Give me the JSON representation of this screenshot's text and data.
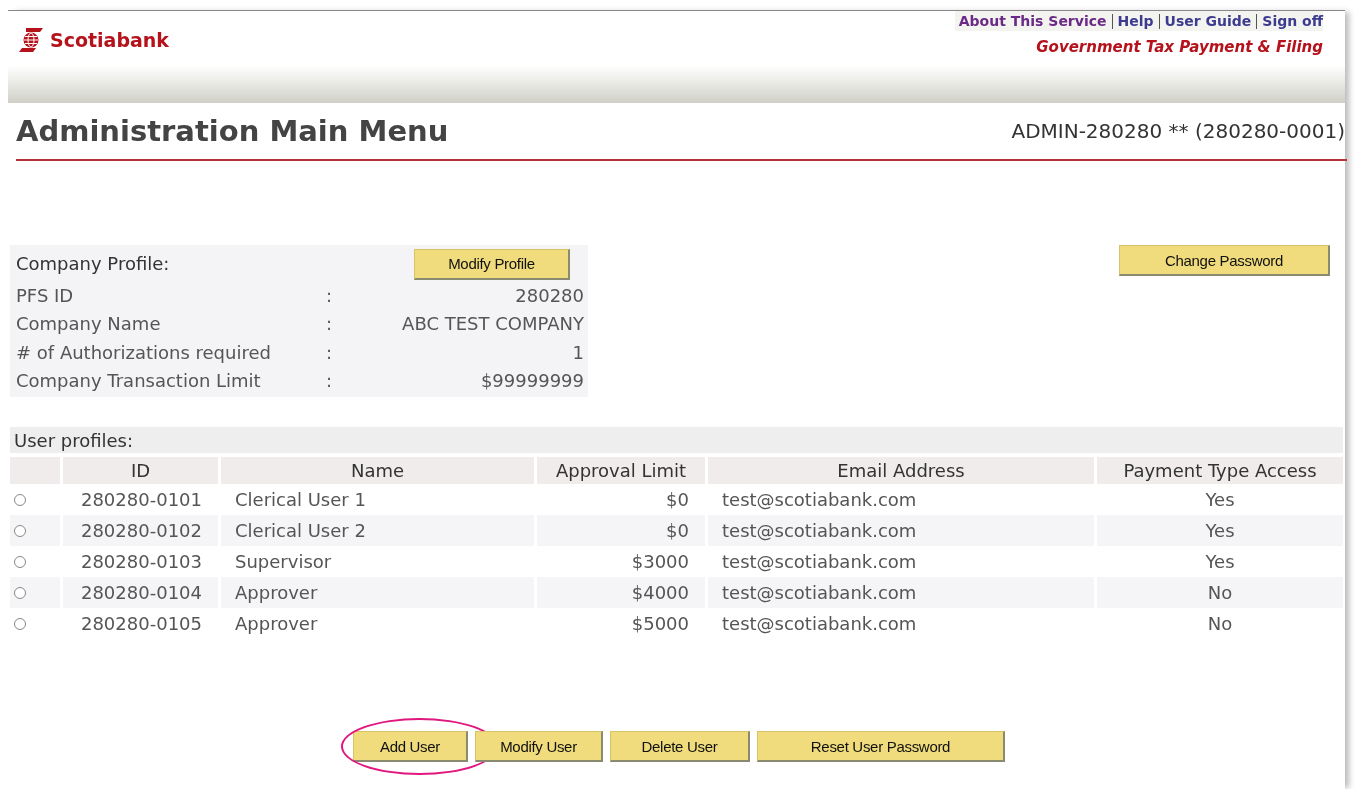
{
  "header": {
    "brand": "Scotiabank",
    "links": [
      "About This Service",
      "Help",
      "User Guide",
      "Sign off"
    ],
    "service": "Government Tax Payment & Filing"
  },
  "page": {
    "title": "Administration Main Menu",
    "user": "ADMIN-280280 ** (280280-0001)"
  },
  "company_profile": {
    "heading": "Company Profile:",
    "button": "Modify Profile",
    "fields": [
      {
        "label": "PFS ID",
        "separator": ":",
        "value": "280280"
      },
      {
        "label": "Company Name",
        "separator": ":",
        "value": "ABC TEST COMPANY"
      },
      {
        "label": "# of Authorizations required",
        "separator": ":",
        "value": "1"
      },
      {
        "label": "Company Transaction Limit",
        "separator": ":",
        "value": "$99999999"
      }
    ]
  },
  "change_password": "Change Password",
  "user_profiles": {
    "heading": "User profiles:",
    "columns": [
      "ID",
      "Name",
      "Approval Limit",
      "Email Address",
      "Payment Type Access"
    ],
    "rows": [
      {
        "selected": false,
        "id": "280280-0101",
        "name": "Clerical User 1",
        "limit": "$0",
        "email": "test@scotiabank.com",
        "access": "Yes"
      },
      {
        "selected": false,
        "id": "280280-0102",
        "name": "Clerical User 2",
        "limit": "$0",
        "email": "test@scotiabank.com",
        "access": "Yes"
      },
      {
        "selected": false,
        "id": "280280-0103",
        "name": "Supervisor",
        "limit": "$3000",
        "email": "test@scotiabank.com",
        "access": "Yes"
      },
      {
        "selected": false,
        "id": "280280-0104",
        "name": "Approver",
        "limit": "$4000",
        "email": "test@scotiabank.com",
        "access": "No"
      },
      {
        "selected": false,
        "id": "280280-0105",
        "name": "Approver",
        "limit": "$5000",
        "email": "test@scotiabank.com",
        "access": "No"
      }
    ]
  },
  "actions": [
    {
      "label": "Add User",
      "highlighted": true
    },
    {
      "label": "Modify User",
      "highlighted": false
    },
    {
      "label": "Delete User",
      "highlighted": false
    },
    {
      "label": "Reset User Password",
      "highlighted": false
    }
  ]
}
